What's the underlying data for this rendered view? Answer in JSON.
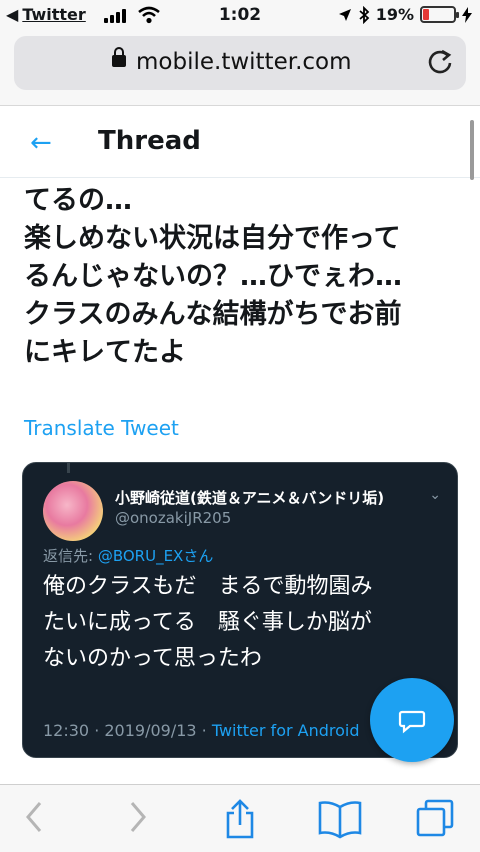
{
  "status_bar": {
    "back_app": "Twitter",
    "time": "1:02",
    "battery_percent": "19%",
    "battery_level": 0.19
  },
  "browser": {
    "url": "mobile.twitter.com"
  },
  "header": {
    "title": "Thread"
  },
  "tweet": {
    "lines": [
      "てるの…",
      "楽しめない状況は自分で作って",
      "るんじゃないの？…ひでぇわ…",
      "クラスのみんな結構がちでお前",
      "にキレてたよ"
    ],
    "translate_label": "Translate Tweet"
  },
  "quoted": {
    "name": "小野崎従道(鉄道＆アニメ＆バンドリ垢)",
    "handle": "@onozakiJR205",
    "reply_prefix": "返信先: ",
    "reply_to": "@BORU_EXさん",
    "lines": [
      "俺のクラスもだ　まるで動物園み",
      "たいに成ってる　騒ぐ事しか脳が",
      "ないのかって思ったわ"
    ],
    "timestamp": "12:30 · 2019/09/13 · ",
    "source": "Twitter for Android"
  },
  "icons": {
    "back": "back-arrow-icon",
    "reply_fab": "compose-reply-icon",
    "toolbar": [
      "back-icon",
      "forward-icon",
      "share-icon",
      "bookmarks-icon",
      "tabs-icon"
    ]
  },
  "colors": {
    "accent": "#1da1f2",
    "card_bg": "#15202b",
    "battery_low": "#e53935"
  }
}
